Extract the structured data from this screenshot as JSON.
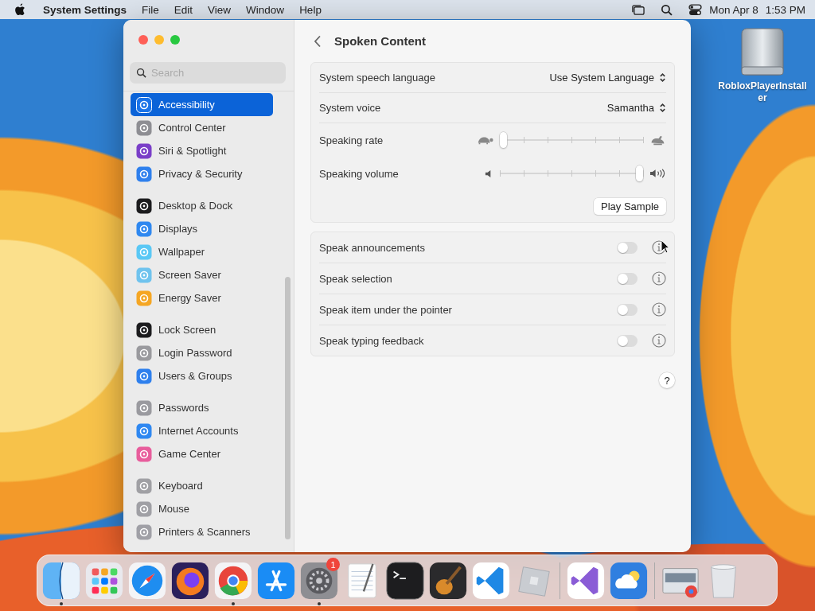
{
  "menubar": {
    "app_name": "System Settings",
    "menus": [
      "File",
      "Edit",
      "View",
      "Window",
      "Help"
    ],
    "date": "Mon Apr 8",
    "time": "1:53 PM"
  },
  "desktop_files": [
    {
      "name": "RobloxPlayerInstaller"
    }
  ],
  "sidebar": {
    "search": {
      "placeholder": "Search"
    },
    "groups": [
      [
        {
          "label": "Accessibility",
          "color": "#1a73e8",
          "selected": true
        },
        {
          "label": "Control Center",
          "color": "#8e8e93",
          "selected": false
        },
        {
          "label": "Siri & Spotlight",
          "color": "#7a3ec8",
          "selected": false
        },
        {
          "label": "Privacy & Security",
          "color": "#2f80ed",
          "selected": false
        }
      ],
      [
        {
          "label": "Desktop & Dock",
          "color": "#1c1c1e",
          "selected": false
        },
        {
          "label": "Displays",
          "color": "#2f88f0",
          "selected": false
        },
        {
          "label": "Wallpaper",
          "color": "#5ac8f5",
          "selected": false
        },
        {
          "label": "Screen Saver",
          "color": "#6fc3ee",
          "selected": false
        },
        {
          "label": "Energy Saver",
          "color": "#f5a623",
          "selected": false
        }
      ],
      [
        {
          "label": "Lock Screen",
          "color": "#1c1c1e",
          "selected": false
        },
        {
          "label": "Login Password",
          "color": "#9a9a9e",
          "selected": false
        },
        {
          "label": "Users & Groups",
          "color": "#2f80ed",
          "selected": false
        }
      ],
      [
        {
          "label": "Passwords",
          "color": "#9a9a9f",
          "selected": false
        },
        {
          "label": "Internet Accounts",
          "color": "#2f88f1",
          "selected": false
        },
        {
          "label": "Game Center",
          "color": "#e85d9c",
          "selected": false
        }
      ],
      [
        {
          "label": "Keyboard",
          "color": "#a0a0a4",
          "selected": false
        },
        {
          "label": "Mouse",
          "color": "#a0a0a5",
          "selected": false
        },
        {
          "label": "Printers & Scanners",
          "color": "#a0a0a6",
          "selected": false
        }
      ]
    ]
  },
  "content": {
    "title": "Spoken Content",
    "voice_settings": [
      {
        "kind": "popup",
        "label": "System speech language",
        "value": "Use System Language"
      },
      {
        "kind": "popup",
        "label": "System voice",
        "value": "Samantha"
      },
      {
        "kind": "slider",
        "label": "Speaking rate",
        "level": 0
      },
      {
        "kind": "slider",
        "label": "Speaking volume",
        "level": 1
      }
    ],
    "play_button": "Play Sample",
    "speech_options": [
      {
        "label": "Speak announcements",
        "on": false
      },
      {
        "label": "Speak selection",
        "on": false
      },
      {
        "label": "Speak item under the pointer",
        "on": false
      },
      {
        "label": "Speak typing feedback",
        "on": false
      }
    ],
    "help_button": "?"
  },
  "dock": {
    "groups": [
      [
        {
          "running": true
        },
        {
          "running": false
        },
        {
          "running": false
        },
        {
          "running": false
        },
        {
          "running": true
        },
        {
          "running": false
        },
        {
          "running": true,
          "badge": "1"
        },
        {
          "running": false
        },
        {
          "running": false
        },
        {
          "running": false
        },
        {
          "running": false
        },
        {
          "running": false
        }
      ],
      [
        {
          "running": false
        },
        {
          "running": false
        }
      ],
      [
        {
          "running": false
        },
        {
          "running": false
        }
      ]
    ]
  }
}
